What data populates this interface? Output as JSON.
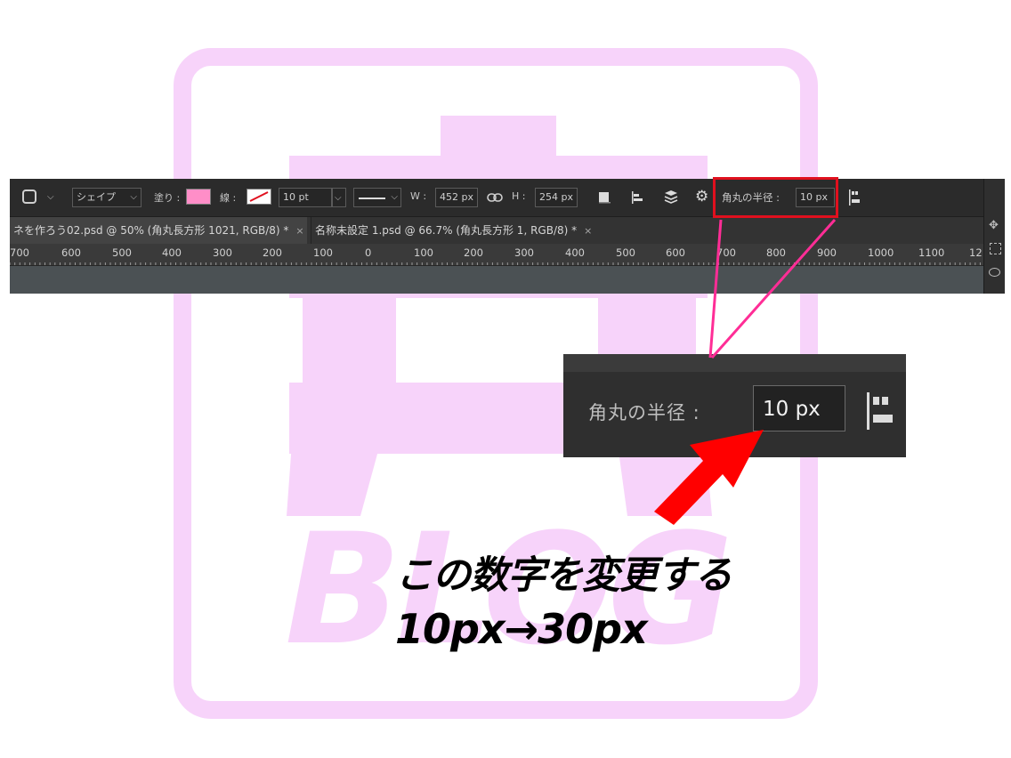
{
  "watermark": {
    "text": "BLOG",
    "color": "#f7d3fa"
  },
  "options_bar": {
    "shape_mode": "シェイプ",
    "fill_label": "塗り :",
    "fill_color": "#ff8ec8",
    "stroke_label": "線 :",
    "stroke_width": "10 pt",
    "w_label": "W :",
    "w_value": "452 px",
    "h_label": "H :",
    "h_value": "254 px",
    "corner_radius_label": "角丸の半径 :",
    "corner_radius_value": "10 px",
    "panel_toggle": "»"
  },
  "tabs": [
    {
      "label": "ネを作ろう02.psd @ 50% (角丸長方形 1021, RGB/8) *",
      "close": "×"
    },
    {
      "label": "名称未設定 1.psd @ 66.7% (角丸長方形 1, RGB/8) *",
      "close": "×"
    }
  ],
  "ruler": [
    "700",
    "600",
    "500",
    "400",
    "300",
    "200",
    "100",
    "0",
    "100",
    "200",
    "300",
    "400",
    "500",
    "600",
    "700",
    "800",
    "900",
    "1000",
    "1100",
    "12"
  ],
  "zoom": {
    "label": "角丸の半径 :",
    "value": "10 px"
  },
  "caption": {
    "line1": "この数字を変更する",
    "line2": "10px→30px"
  },
  "colors": {
    "highlight_box": "#e0101e",
    "callout_line": "#ff2d96",
    "arrow": "#ff0000"
  }
}
